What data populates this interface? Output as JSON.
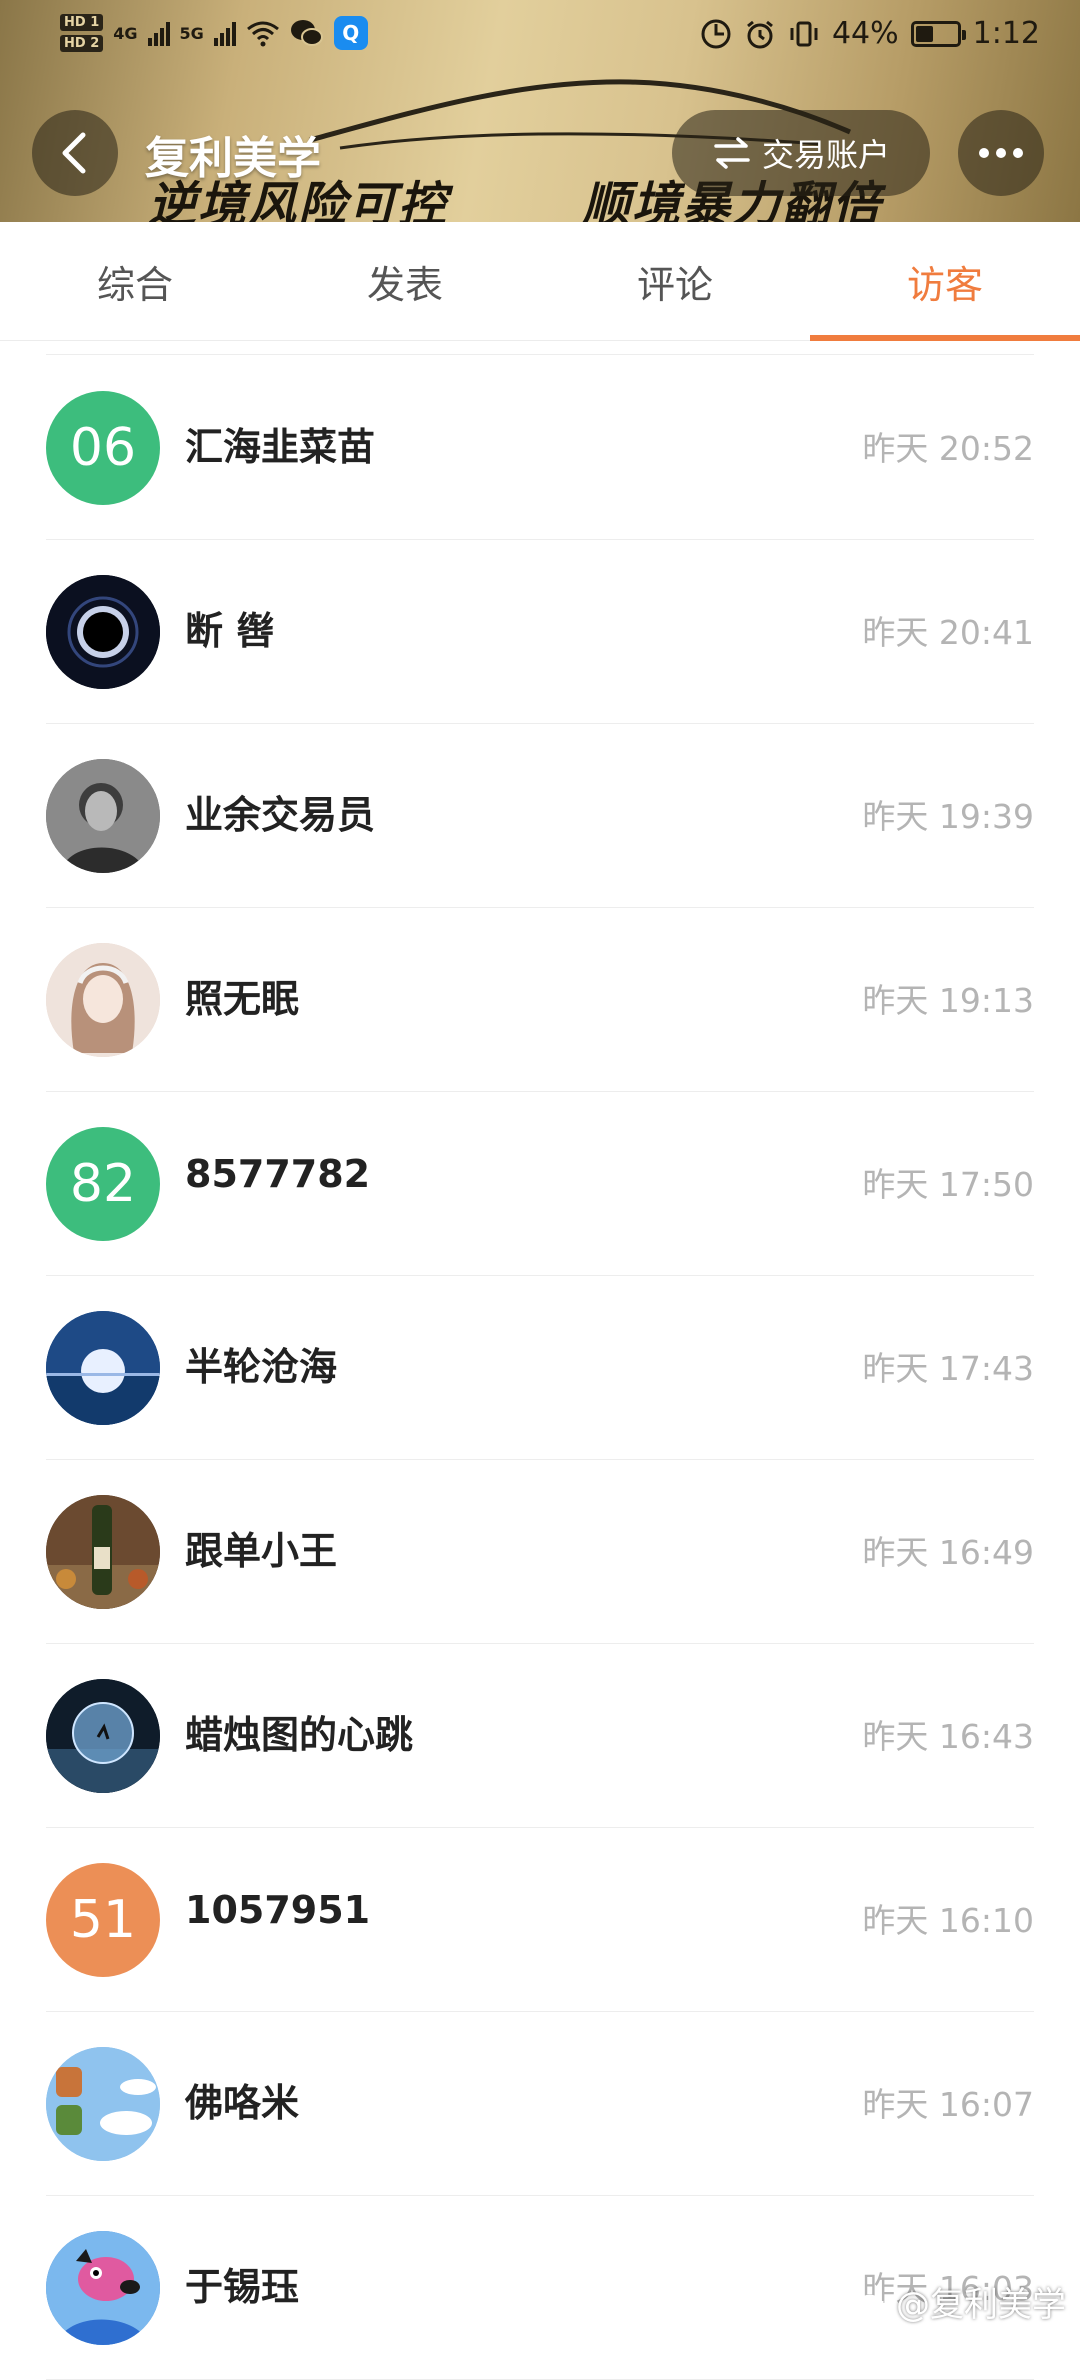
{
  "status_bar": {
    "hd1": "HD 1",
    "hd2": "HD 2",
    "net1": "4G",
    "net2": "5G",
    "battery_pct": "44%",
    "battery_level": 0.44,
    "time": "1:12"
  },
  "header": {
    "title": "复利美学",
    "slogan_left": "逆境风险可控",
    "slogan_right": "顺境暴力翻倍",
    "account_button": "交易账户"
  },
  "tabs": [
    {
      "label": "综合",
      "active": false
    },
    {
      "label": "发表",
      "active": false
    },
    {
      "label": "评论",
      "active": false
    },
    {
      "label": "访客",
      "active": true
    }
  ],
  "visitors": [
    {
      "name": "汇海韭菜苗",
      "time": "昨天 20:52",
      "avatar_text": "06",
      "avatar_icon": "number-avatar",
      "avatar_color": "#3dbd7d"
    },
    {
      "name": "断 辔",
      "time": "昨天 20:41",
      "avatar_text": "",
      "avatar_icon": "eclipse-avatar",
      "avatar_color": "#0b1020"
    },
    {
      "name": "业余交易员",
      "time": "昨天 19:39",
      "avatar_text": "",
      "avatar_icon": "man-portrait-avatar",
      "avatar_color": "#6f6f6f"
    },
    {
      "name": "照无眠",
      "time": "昨天 19:13",
      "avatar_text": "",
      "avatar_icon": "girl-illustration-avatar",
      "avatar_color": "#e8d6cc"
    },
    {
      "name": "8577782",
      "time": "昨天 17:50",
      "avatar_text": "82",
      "avatar_icon": "number-avatar",
      "avatar_color": "#3dbd7d"
    },
    {
      "name": "半轮沧海",
      "time": "昨天 17:43",
      "avatar_text": "",
      "avatar_icon": "moon-sea-avatar",
      "avatar_color": "#1f4f8a"
    },
    {
      "name": "跟单小王",
      "time": "昨天 16:49",
      "avatar_text": "",
      "avatar_icon": "wine-bottle-avatar",
      "avatar_color": "#5a3a24"
    },
    {
      "name": "蜡烛图的心跳",
      "time": "昨天 16:43",
      "avatar_text": "",
      "avatar_icon": "glass-sphere-avatar",
      "avatar_color": "#1a2a3a"
    },
    {
      "name": "1057951",
      "time": "昨天 16:10",
      "avatar_text": "51",
      "avatar_icon": "number-avatar",
      "avatar_color": "#ec8f56"
    },
    {
      "name": "佛咯米",
      "time": "昨天 16:07",
      "avatar_text": "",
      "avatar_icon": "sky-cartoon-avatar",
      "avatar_color": "#8fc3ee"
    },
    {
      "name": "于锡珏",
      "time": "昨天 16:03",
      "avatar_text": "",
      "avatar_icon": "cartoon-dog-avatar",
      "avatar_color": "#4a8ad8"
    }
  ],
  "watermark": "@复利美学",
  "colors": {
    "accent": "#f07c3e",
    "time_text": "#b4b4b4",
    "name_text": "#222222"
  }
}
